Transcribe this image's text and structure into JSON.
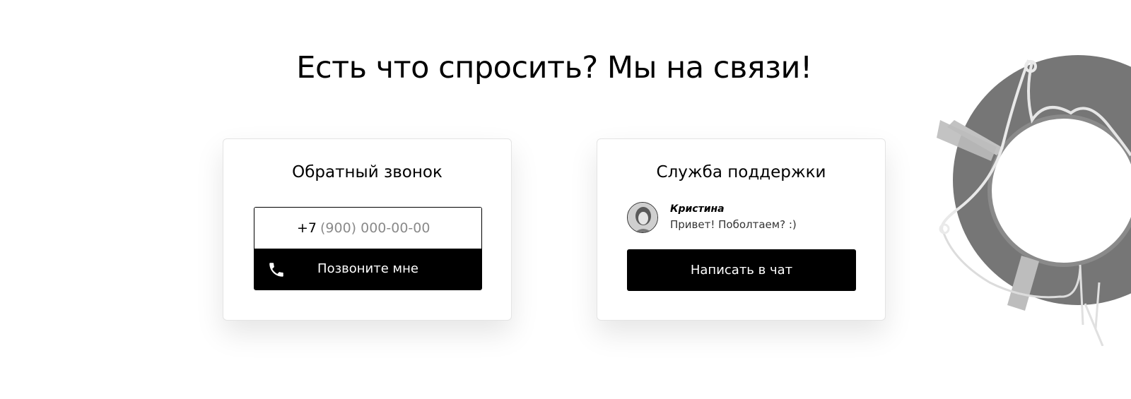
{
  "heading": "Есть что спросить? Мы на связи!",
  "callback": {
    "title": "Обратный звонок",
    "phone_prefix": "+7",
    "phone_placeholder": "(900) 000-00-00",
    "phone_value": "",
    "button_label": "Позвоните мне",
    "button_icon": "phone-icon"
  },
  "support": {
    "title": "Служба поддержки",
    "agent_name": "Кристина",
    "agent_message": "Привет! Поболтаем? :)",
    "button_label": "Написать в чат"
  },
  "colors": {
    "button_bg": "#000000",
    "button_text": "#ffffff",
    "placeholder": "#8a8a8a",
    "lifebuoy": "#7a7a7a",
    "lifebuoy_band": "#bdbdbd"
  }
}
